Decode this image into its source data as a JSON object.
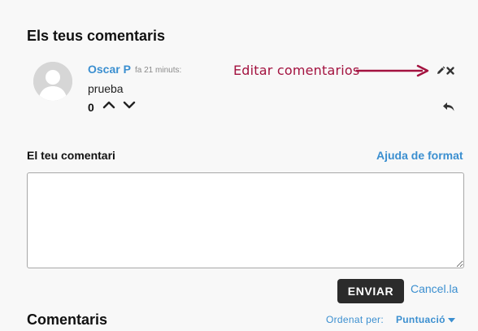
{
  "section": {
    "title": "Els teus comentaris"
  },
  "comment": {
    "author": "Oscar P",
    "time": "fa 21 minuts:",
    "text": "prueba",
    "votes": "0"
  },
  "annotation": {
    "text": "Editar comentarios",
    "color": "#a3123f"
  },
  "icons": {
    "avatar": "user-silhouette",
    "edit": "pencil-icon",
    "delete": "x-icon",
    "reply": "reply-arrow-icon",
    "vote_up": "chevron-up-icon",
    "vote_down": "chevron-down-icon"
  },
  "form": {
    "label": "El teu comentari",
    "help_link": "Ajuda de format",
    "textarea_value": "",
    "send_button": "ENVIAR",
    "cancel_link": "Cancel.la"
  },
  "comments": {
    "heading": "Comentaris",
    "sort_label": "Ordenat per:",
    "sort_value": "Puntuació"
  },
  "colors": {
    "link": "#3b8fd0",
    "button_bg": "#2b2b2b",
    "background": "#f8f8f8"
  }
}
